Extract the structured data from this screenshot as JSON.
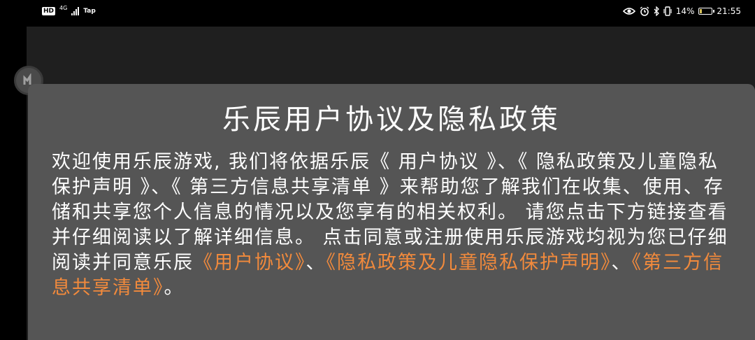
{
  "status_bar": {
    "hd": "HD",
    "network": "4G",
    "tap": "Tap",
    "battery_percent": "14%",
    "battery_level": 0.14,
    "time": "21:55"
  },
  "dialog": {
    "title": "乐辰用户协议及隐私政策",
    "body": {
      "part1": "欢迎使用乐辰游戏, 我们将依据乐辰《 用户协议 》、《 隐私政策及儿童隐私保护声明 》、《 第三方信息共享清单 》来帮助您了解我们在收集、使用、存储和共享您个人信息的情况以及您享有的相关权利。 请您点击下方链接查看并仔细阅读以了解详细信息。 点击同意或注册使用乐辰游戏均视为您已仔细阅读并同意乐辰",
      "link_user_agreement": "《用户协议》",
      "sep1": "、",
      "link_privacy_policy": "《隐私政策及儿童隐私保护声明》",
      "sep2": "、",
      "link_third_party": "《第三方信息共享清单》",
      "end": "。"
    }
  },
  "colors": {
    "link": "#f28a3c",
    "dialog_bg": "#555555",
    "app_bg": "#1f1f1f"
  }
}
